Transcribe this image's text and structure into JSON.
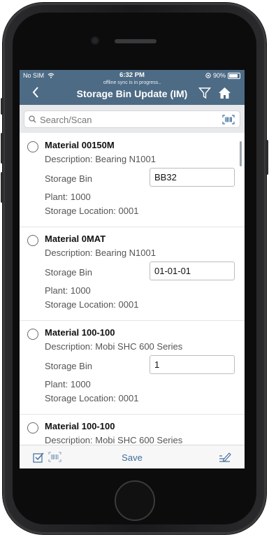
{
  "status": {
    "carrier": "No SIM",
    "time": "6:32 PM",
    "battery": "90%",
    "sync_text": "offline sync is in progress.."
  },
  "nav": {
    "title": "Storage Bin Update (IM)",
    "back_icon": "chevron-left-icon",
    "filter_icon": "filter-icon",
    "home_icon": "home-icon"
  },
  "search": {
    "placeholder": "Search/Scan",
    "value": ""
  },
  "items": [
    {
      "material": "Material 00150M",
      "description": "Description: Bearing N1001",
      "bin_label": "Storage Bin",
      "bin_value": "BB32",
      "plant": "Plant: 1000",
      "storage_location": "Storage Location: 0001"
    },
    {
      "material": "Material 0MAT",
      "description": "Description: Bearing N1001",
      "bin_label": "Storage Bin",
      "bin_value": "01-01-01",
      "plant": "Plant: 1000",
      "storage_location": "Storage Location: 0001"
    },
    {
      "material": "Material 100-100",
      "description": "Description: Mobi SHC 600 Series",
      "bin_label": "Storage Bin",
      "bin_value": "1",
      "plant": "Plant: 1000",
      "storage_location": "Storage Location: 0001"
    },
    {
      "material": "Material 100-100",
      "description": "Description: Mobi SHC 600 Series"
    }
  ],
  "toolbar": {
    "save_label": "Save"
  },
  "colors": {
    "header": "#4d6b85",
    "accent": "#3f6d9c"
  }
}
